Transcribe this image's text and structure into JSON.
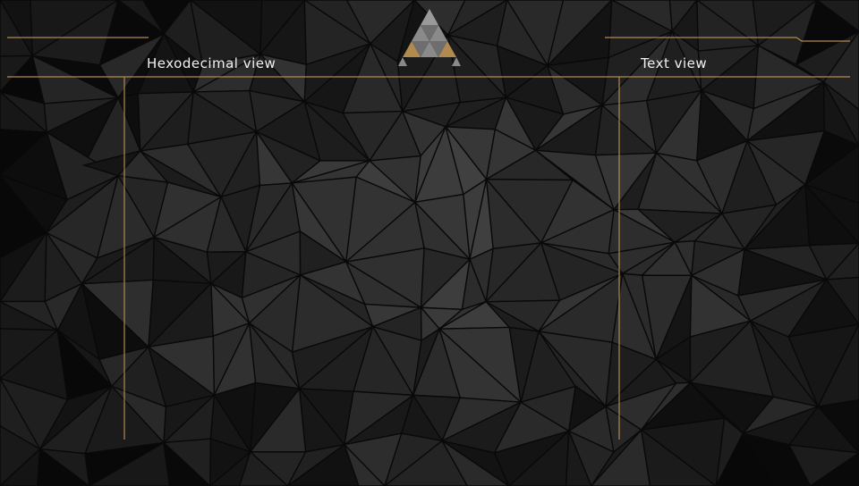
{
  "views": {
    "hex_title": "Hexodecimal view",
    "text_title": "Text view"
  },
  "logo": {
    "icon": "triforce-logo-icon",
    "colors": {
      "top": "#9a9a9a",
      "corners": "#b08a4e",
      "middle": "#8a8a8a"
    }
  },
  "theme": {
    "accent": "#b08a4e",
    "background": "#1e1e1e"
  }
}
